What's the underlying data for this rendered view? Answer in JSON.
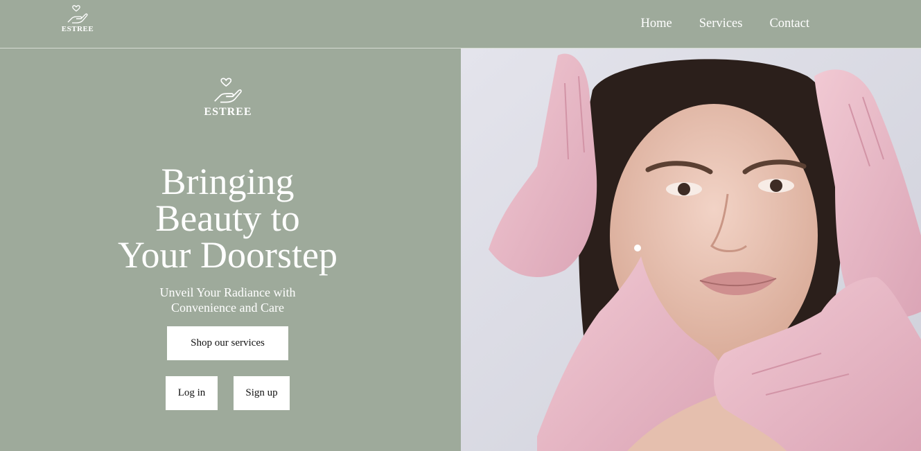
{
  "header": {
    "brand": "ESTREE",
    "logo_icon": "heart-in-hand-icon",
    "nav": [
      {
        "label": "Home"
      },
      {
        "label": "Services"
      },
      {
        "label": "Contact"
      }
    ]
  },
  "hero": {
    "brand": "ESTREE",
    "logo_icon": "heart-in-hand-icon",
    "headline_lines": [
      "Bringing",
      "Beauty to",
      "Your Doorstep"
    ],
    "subtitle_lines": [
      "Unveil Your Radiance with",
      "Convenience and Care"
    ],
    "shop_button": "Shop our services",
    "login_button": "Log in",
    "signup_button": "Sign up"
  },
  "image": {
    "subject": "woman-face-with-pink-gloved-hands-photo"
  },
  "colors": {
    "background": "#9eaa9b",
    "text": "#ffffff",
    "button_bg": "#ffffff",
    "button_text": "#111111",
    "glove_pink": "#e8b8c4",
    "photo_bg": "#dcdde6"
  }
}
